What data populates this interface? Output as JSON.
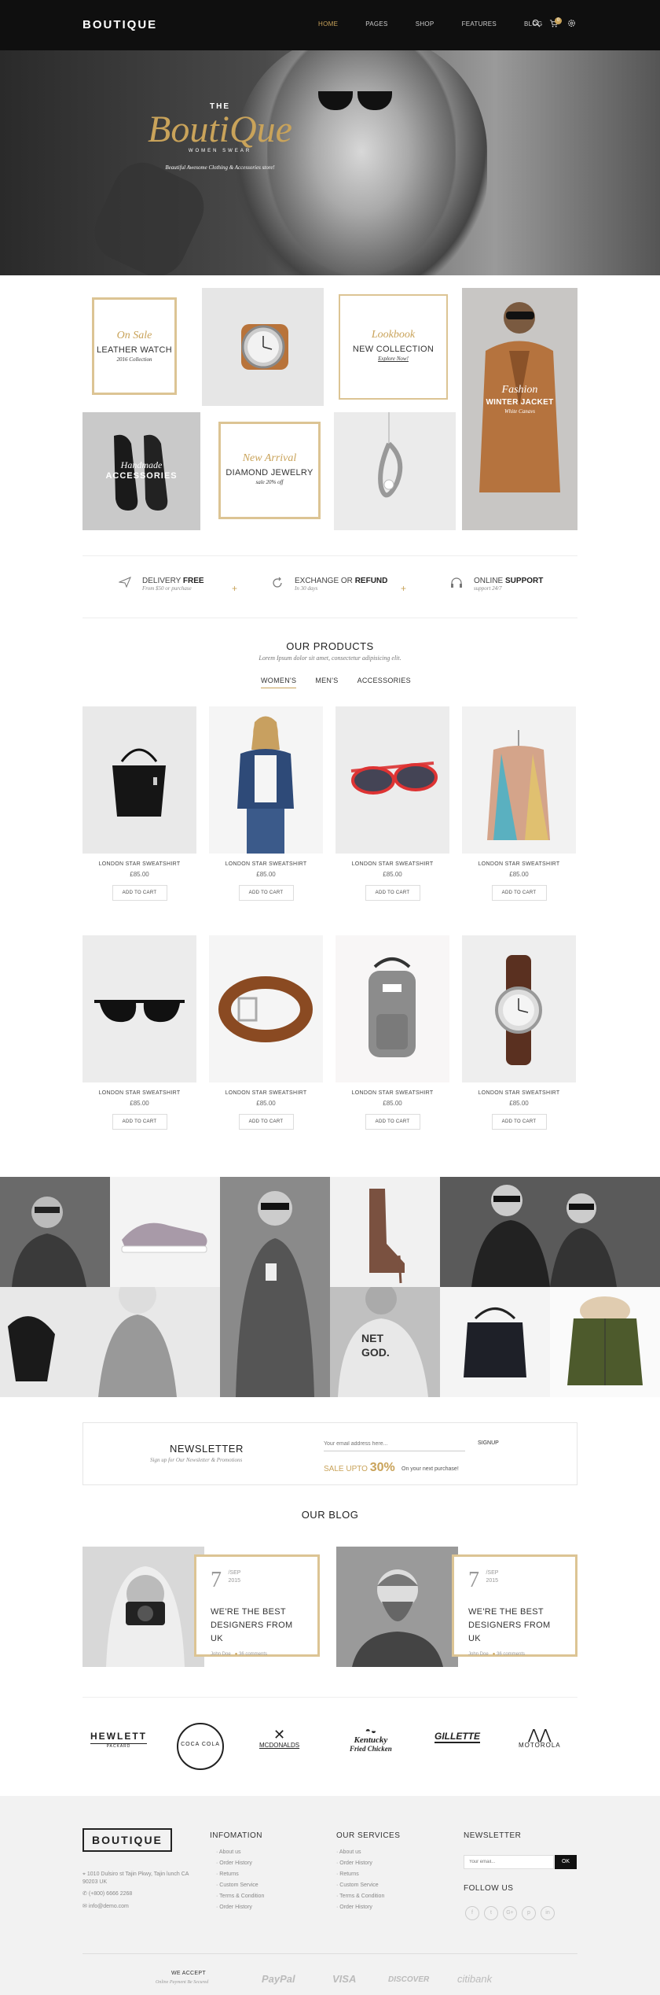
{
  "header": {
    "logo": "BOUTIQUE",
    "nav": [
      "HOME",
      "PAGES",
      "SHOP",
      "FEATURES",
      "BLOG"
    ],
    "active_nav": "HOME",
    "cart_count": "0",
    "icons": [
      "search-icon",
      "cart-icon",
      "settings-icon"
    ]
  },
  "hero": {
    "the": "THE",
    "brand": "BoutiQue",
    "subtitle": "WOMEN SWEAR",
    "description": "Beautiful Awesome Clothing & Accessories store!"
  },
  "promos": {
    "sale": {
      "script": "On Sale",
      "title": "LEATHER WATCH",
      "sub": "2016 Collection"
    },
    "lookbook": {
      "script": "Lookbook",
      "title": "NEW COLLECTION",
      "sub": "Explore Now!"
    },
    "fashion": {
      "script": "Fashion",
      "title": "WINTER JACKET",
      "sub": "White Canavs"
    },
    "handmade": {
      "script": "Handmade",
      "title": "ACCESSORIES"
    },
    "arrival": {
      "script": "New Arrival",
      "title": "DIAMOND JEWELRY",
      "sub": "sale 20% off"
    }
  },
  "features": [
    {
      "icon": "paper-plane-icon",
      "title_pre": "DELIVERY ",
      "title_bold": "FREE",
      "sub": "From $50 or purchase"
    },
    {
      "icon": "refresh-icon",
      "title_pre": "EXCHANGE OR ",
      "title_bold": "REFUND",
      "sub": "In 30 days"
    },
    {
      "icon": "headphones-icon",
      "title_pre": "ONLINE ",
      "title_bold": "SUPPORT",
      "sub": "support 24/7"
    }
  ],
  "products": {
    "heading": "OUR PRODUCTS",
    "description": "Lorem Ipsum dolor sit amet, consectetur adipisicing elit.",
    "tabs": [
      "WOMEN'S",
      "MEN'S",
      "ACCESSORIES"
    ],
    "active_tab": "WOMEN'S",
    "items": [
      {
        "name": "LONDON STAR SWEATSHIRT",
        "price": "£85.00",
        "button": "ADD TO CART",
        "icon": "handbag-icon"
      },
      {
        "name": "LONDON STAR SWEATSHIRT",
        "price": "£85.00",
        "button": "ADD TO CART",
        "icon": "denim-jacket-icon"
      },
      {
        "name": "LONDON STAR SWEATSHIRT",
        "price": "£85.00",
        "button": "ADD TO CART",
        "icon": "sunglasses-icon"
      },
      {
        "name": "LONDON STAR SWEATSHIRT",
        "price": "£85.00",
        "button": "ADD TO CART",
        "icon": "scarf-icon"
      },
      {
        "name": "LONDON STAR SWEATSHIRT",
        "price": "£85.00",
        "button": "ADD TO CART",
        "icon": "sunglasses-icon"
      },
      {
        "name": "LONDON STAR SWEATSHIRT",
        "price": "£85.00",
        "button": "ADD TO CART",
        "icon": "belt-icon"
      },
      {
        "name": "LONDON STAR SWEATSHIRT",
        "price": "£85.00",
        "button": "ADD TO CART",
        "icon": "backpack-icon"
      },
      {
        "name": "LONDON STAR SWEATSHIRT",
        "price": "£85.00",
        "button": "ADD TO CART",
        "icon": "watch-icon"
      }
    ]
  },
  "newsletter": {
    "title": "NEWSLETTER",
    "description": "Sign up for Our Newsletter & Promotions",
    "placeholder": "Your email address here...",
    "button": "SIGNUP",
    "sale_pre": "SALE UPTO ",
    "sale_value": "30%",
    "sale_post": "On your next purchase!"
  },
  "blog": {
    "heading": "OUR BLOG",
    "posts": [
      {
        "day": "7",
        "month": "/SEP",
        "year": "2015",
        "title": "WE'RE THE BEST DESIGNERS FROM UK",
        "author": "John Doe",
        "comments": "36 comments"
      },
      {
        "day": "7",
        "month": "/SEP",
        "year": "2015",
        "title": "WE'RE THE BEST DESIGNERS FROM UK",
        "author": "John Doe",
        "comments": "36 comments"
      }
    ]
  },
  "brands": [
    {
      "name": "HEWLETT",
      "sub": "PACKARD"
    },
    {
      "name": "COCA COLA",
      "sub": ""
    },
    {
      "name": "MCDONALDS",
      "sub": ""
    },
    {
      "name": "Kentucky",
      "sub": "Fried Chicken"
    },
    {
      "name": "GILLETTE",
      "sub": ""
    },
    {
      "name": "MOTOROLA",
      "sub": ""
    }
  ],
  "footer": {
    "logo": "BOUTIQUE",
    "address": "1010 Dulsiro st Tajin Pkwy, Tajin lunch CA 90203 UK",
    "phone": "(+800) 6666 2268",
    "email": "info@demo.com",
    "info_heading": "INFOMATION",
    "info_links": [
      "About us",
      "Order History",
      "Returns",
      "Custom Service",
      "Terms & Condition",
      "Order History"
    ],
    "services_heading": "OUR SERVICES",
    "services_links": [
      "About us",
      "Order History",
      "Returns",
      "Custom Service",
      "Terms & Condition",
      "Order History"
    ],
    "newsletter_heading": "NEWSLETTER",
    "newsletter_placeholder": "Your email...",
    "newsletter_button": "OK",
    "follow_heading": "FOLLOW US",
    "social": [
      "f",
      "t",
      "G+",
      "p",
      "in"
    ],
    "we_accept": "WE ACCEPT",
    "payment_note": "Online Payment Be Secured",
    "payments": [
      "PayPal",
      "VISA",
      "DISCOVER",
      "citibank"
    ]
  },
  "colors": {
    "accent": "#c9a35a",
    "header_bg": "#0f0f0f",
    "footer_bg": "#f2f2f2"
  }
}
